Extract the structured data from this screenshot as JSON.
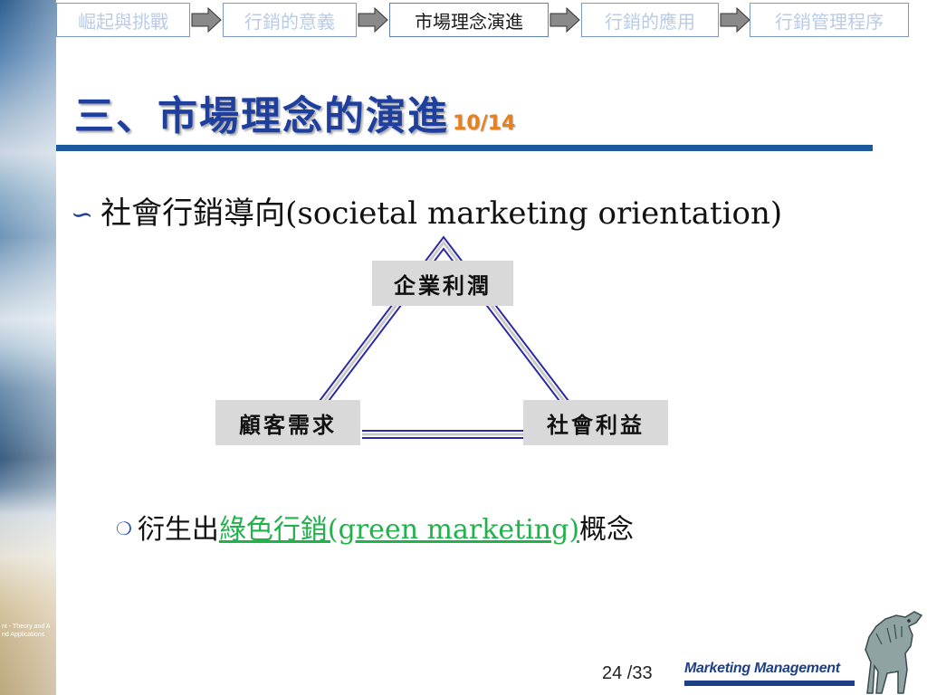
{
  "nav": {
    "steps": [
      {
        "label": "崛起與挑戰",
        "active": false
      },
      {
        "label": "行銷的意義",
        "active": false
      },
      {
        "label": "市場理念演進",
        "active": true
      },
      {
        "label": "行銷的應用",
        "active": false
      },
      {
        "label": "行銷管理程序",
        "active": false
      }
    ]
  },
  "side_photo_text": [
    "nt - Theory and A",
    "nd Applications"
  ],
  "title": {
    "text": "三、市場理念的演進",
    "pager": "10/14"
  },
  "bullet": {
    "glyph": "∽",
    "text": "社會行銷導向(societal marketing orientation)"
  },
  "diagram": {
    "top": "企業利潤",
    "left": "顧客需求",
    "right": "社會利益"
  },
  "sub_bullet": {
    "glyph": "❍",
    "prefix": "衍生出",
    "link": "綠色行銷(green marketing)",
    "suffix": "概念"
  },
  "footer": {
    "page": "24 /33",
    "brand": "Marketing Management"
  },
  "colors": {
    "title": "#1f3f9f",
    "pager": "#e8801c",
    "rule": "#1c5a9e",
    "link": "#22b24c",
    "triangle": "#2a2aa8"
  }
}
